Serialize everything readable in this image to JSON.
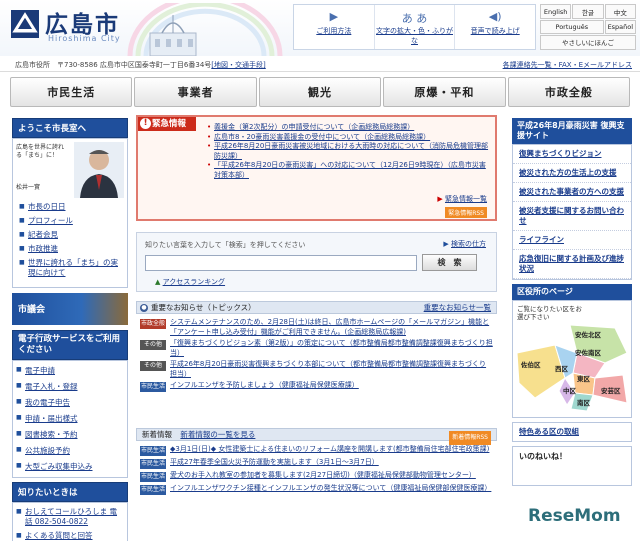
{
  "header": {
    "logo_title": "広島市",
    "logo_subtitle": "Hiroshima City",
    "utilities": [
      {
        "icon": "guide-icon",
        "label": "ご利用方法"
      },
      {
        "icon": "text-size-icon",
        "glyph": "あ あ",
        "label": "文字の拡大・色・ふりがな"
      },
      {
        "icon": "speaker-icon",
        "label": "音声で読み上げ"
      }
    ],
    "languages": [
      "English",
      "한글",
      "中文",
      "Português",
      "Español",
      "やさしいにほんご"
    ]
  },
  "address": {
    "text": "広島市役所　〒730-8586 広島市中区国泰寺町一丁目6番34号",
    "map_link": "[地図・交通手段]",
    "contact_link": "各課連絡先一覧・FAX・Eメールアドレス"
  },
  "nav": {
    "tabs": [
      "市民生活",
      "事業者",
      "観光",
      "原爆・平和",
      "市政全般"
    ]
  },
  "left": {
    "mayor_head": "ようこそ市長室へ",
    "mayor_note": "広島を世界に誇れる「まち」に！",
    "mayor_name": "松井一實",
    "mayor_links": [
      "市長の日日",
      "プロフィール",
      "記者会見",
      "市政推進",
      "世界に誇れる「まち」の実現に向けて"
    ],
    "council_head": "市議会",
    "eservice_head": "電子行政サービスをご利用ください",
    "eservice_links": [
      "電子申請",
      "電子入札・登録",
      "我の電子申告",
      "申請・届出様式",
      "図書検索・予約",
      "公共施設予約",
      "大型ごみ収集申込み"
    ],
    "help_head": "知りたいときは",
    "help_links": [
      "おしえてコールひろしま 電話 082-504-0822",
      "よくある質問と回答"
    ]
  },
  "emergency": {
    "label": "緊急情報",
    "items": [
      "義援金（第2次配分）の申請受付について（企画総務局総務課）",
      "広島市8・20豪雨災害義援金の受付中について（企画総務局総務課）",
      "平成26年8月20日豪雨災害被災地域における大雨時の対応について（消防局危機管理部防災課）",
      "「平成26年8月20日の豪雨災害」への対応について（12月26日9時現在）（広島市災害対策本部）"
    ],
    "list_link": "緊急情報一覧",
    "rss": "緊急情報RSS"
  },
  "search": {
    "hint": "知りたい言葉を入力して「検索」を押してください",
    "how_link": "検索の仕方",
    "placeholder": "",
    "button": "検　索",
    "ranking": "アクセスランキング"
  },
  "important": {
    "head": "重要なお知らせ（トピックス）",
    "list_link": "重要なお知らせ一覧",
    "rows": [
      {
        "tag": "市政全般",
        "color": "red",
        "text": "システムメンテナンスのため、2月28日(土)は終日、広島市ホームページの「メールマガジン」機能と「アンケート申し込み受付」機能がご利用できません。(企画総務局広報課)"
      },
      {
        "tag": "その他",
        "color": "dark",
        "text": "「復興まちづくりビジョン素（第2版）」の策定について（都市整備局都市整備調整課復興まちづくり担当）"
      },
      {
        "tag": "その他",
        "color": "dark",
        "text": "平成26年8月20日豪雨災害復興まちづくり本部について（都市整備局都市整備調整課復興まちづくり担当）"
      },
      {
        "tag": "市民生活",
        "color": "blue",
        "text": "インフルエンザを予防しましょう（健康福祉局保健医療課）"
      }
    ]
  },
  "new_info": {
    "head": "新着情報",
    "list_link": "新着情報の一覧を見る",
    "rss": "新着情報RSS",
    "rows": [
      {
        "tag": "市民生活",
        "color": "blue",
        "text": "◆3月1日(日)◆ 女性建築士による住まいのリフォーム講座を開講します(都市整備局住宅部住宅政策課)"
      },
      {
        "tag": "市民生活",
        "color": "blue",
        "text": "平成27年春季全国火災予防運動を実施します（3月1日～3月7日）"
      },
      {
        "tag": "市民生活",
        "color": "blue",
        "text": "愛犬のお手入れ教室の参加者を募集します(2月27日締切)（健康福祉局保健部動物管理センター）"
      },
      {
        "tag": "市民生活",
        "color": "blue",
        "text": "インフルエンザワクチン接種とインフルエンザの発生状況等について（健康福祉局保健部保健医療課）"
      }
    ]
  },
  "right": {
    "disaster_head": "平成26年8月豪雨災害 復興支援サイト",
    "links": [
      "復興まちづくりビジョン",
      "被災された方の生活上の支援",
      "被災された事業者の方への支援",
      "被災者支援に関するお問い合わせ",
      "ライフライン",
      "応急復旧に関する計画及び進捗状況"
    ],
    "ward_head": "区役所のページ",
    "ward_note": "ご覧になりたい区をお選び下さい",
    "wards": [
      "安佐北区",
      "安佐南区",
      "佐伯区",
      "西区",
      "東区",
      "中区",
      "南区",
      "安芸区"
    ],
    "special": "特色ある区の取組",
    "iine": "いのねいね！",
    "watermark": "ReseMom"
  }
}
